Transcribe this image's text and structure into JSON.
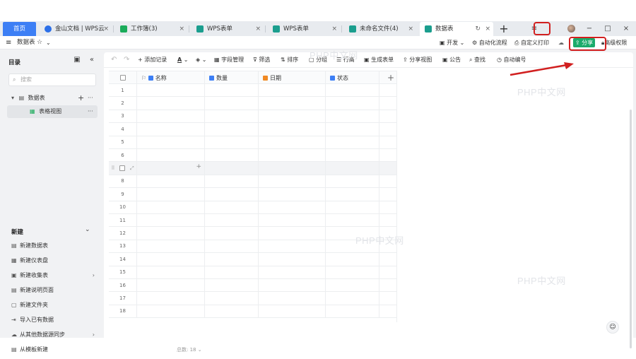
{
  "tabs": {
    "home": "首页",
    "items": [
      {
        "label": "金山文档 | WPS云",
        "icon_color": "#2b6fe8",
        "active": false
      },
      {
        "label": "工作簿(3)",
        "icon_color": "#1aab5a",
        "active": false
      },
      {
        "label": "WPS表单",
        "icon_color": "#1b9e8e",
        "active": false
      },
      {
        "label": "WPS表单",
        "icon_color": "#1b9e8e",
        "active": false
      },
      {
        "label": "未命名文件(4)",
        "icon_color": "#1b9e8e",
        "active": false
      },
      {
        "label": "数据表",
        "icon_color": "#1b9e8e",
        "active": true
      }
    ],
    "close_glyph": "×",
    "refresh_glyph": "↻",
    "add_glyph": "+"
  },
  "window": {
    "minimize": "−",
    "maximize": "□",
    "close": "×",
    "menu": "≡"
  },
  "app_toolbar": {
    "menu_glyph": "≡",
    "title": "数据表",
    "star": "☆",
    "caret": "⌄",
    "dev": "开发",
    "automation": "自动化流程",
    "custom_print": "自定义打印",
    "share": "分享",
    "advanced_perm": "高级权限"
  },
  "sidebar": {
    "title": "目录",
    "search_placeholder": "搜索",
    "table_name": "数据表",
    "view_name": "表格视图",
    "new_title": "新建",
    "new_items": [
      {
        "icon": "▤",
        "label": "新建数据表",
        "arrow": ""
      },
      {
        "icon": "▦",
        "label": "新建仪表盘",
        "arrow": ""
      },
      {
        "icon": "▣",
        "label": "新建收集表",
        "arrow": "›"
      },
      {
        "icon": "▤",
        "label": "新建说明页面",
        "arrow": ""
      },
      {
        "icon": "▢",
        "label": "新建文件夹",
        "arrow": ""
      },
      {
        "icon": "⇥",
        "label": "导入已有数据",
        "arrow": ""
      },
      {
        "icon": "☁",
        "label": "从其他数据源同步",
        "arrow": "›"
      },
      {
        "icon": "▤",
        "label": "从模板新建",
        "arrow": ""
      }
    ]
  },
  "main_toolbar": {
    "undo": "↶",
    "redo": "↷",
    "add_record": "+ 添加记录",
    "text_color": "A",
    "fill": "◈",
    "field_manage": "字段管理",
    "filter": "筛选",
    "sort": "排序",
    "group": "分组",
    "row_height": "行高",
    "gen_form": "生成表单",
    "share_view": "分享视图",
    "notice": "公告",
    "find": "查找",
    "auto_mgmt": "自动编号"
  },
  "grid": {
    "columns": [
      {
        "label": "名称",
        "icon_color": "#3d7ff5"
      },
      {
        "label": "数量",
        "icon_color": "#3d7ff5"
      },
      {
        "label": "日期",
        "icon_color": "#f08a24"
      },
      {
        "label": "状态",
        "icon_color": "#3d7ff5"
      }
    ],
    "add_column": "+",
    "row_numbers": [
      "1",
      "2",
      "3",
      "4",
      "5",
      "6",
      "",
      "8",
      "9",
      "10",
      "11",
      "12",
      "13",
      "14",
      "15",
      "16",
      "17",
      "18"
    ],
    "hover_add": "+",
    "footer": "总数: 18 ⌄"
  },
  "help_glyph": "☺",
  "watermark": "PHP中文网",
  "colors": {
    "accent": "#3d7ff5",
    "share_green": "#1aab6b",
    "annotation_red": "#d11f1f"
  }
}
